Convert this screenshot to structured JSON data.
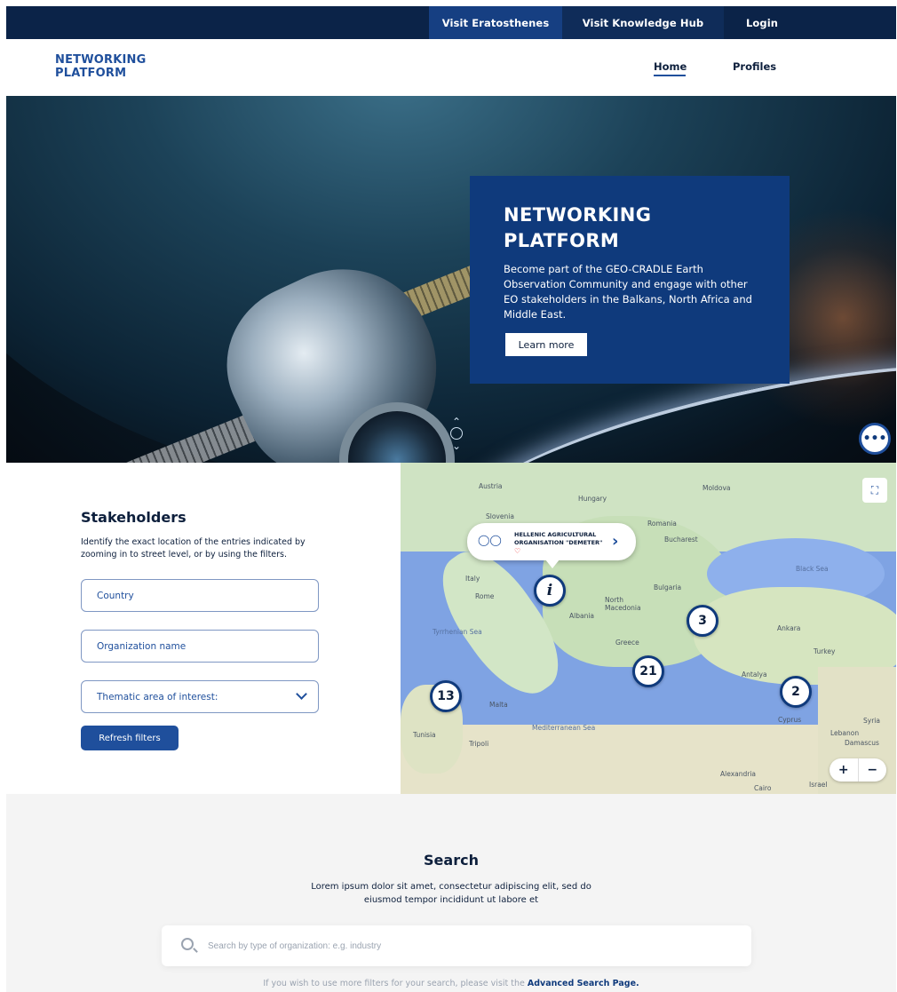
{
  "topbar": {
    "visit_eratosthenes": "Visit Eratosthenes",
    "visit_knowledge_hub": "Visit Knowledge Hub",
    "login": "Login"
  },
  "header": {
    "logo_line1": "NETWORKING",
    "logo_line2": "PLATFORM",
    "nav_home": "Home",
    "nav_profiles": "Profiles"
  },
  "hero": {
    "title_line1": "NETWORKING",
    "title_line2": "PLATFORM",
    "text": "Become part of the GEO-CRADLE Earth Observation Community and engage with other EO stakeholders in the Balkans, North Africa and Middle East.",
    "button": "Learn more",
    "chat_icon": "chat-bubble-icon"
  },
  "stakeholders": {
    "title": "Stakeholders",
    "description": "Identify the exact location of the entries indicated by zooming in to street level, or by using the filters.",
    "country_label": "Country",
    "organization_label": "Organization name",
    "thematic_label": "Thematic area of interest:",
    "refresh_button": "Refresh filters"
  },
  "map": {
    "popup_title": "HELLENIC AGRICULTURAL ORGANISATION \"DEMETER\"",
    "popup_heart": "♡",
    "popup_arrow": "›",
    "marker_info": "i",
    "clusters": [
      "3",
      "21",
      "13",
      "2"
    ],
    "labels": {
      "austria": "Austria",
      "hungary": "Hungary",
      "slovenia": "Slovenia",
      "romania": "Romania",
      "bucharest": "Bucharest",
      "moldova": "Moldova",
      "italy": "Italy",
      "rome": "Rome",
      "bulgaria": "Bulgaria",
      "north_macedonia": "North Macedonia",
      "albania": "Albania",
      "greece": "Greece",
      "turkey": "Turkey",
      "ankara": "Ankara",
      "antalya": "Antalya",
      "cyprus": "Cyprus",
      "syria": "Syria",
      "lebanon": "Lebanon",
      "damascus": "Damascus",
      "israel": "Israel",
      "malta": "Malta",
      "tunisia": "Tunisia",
      "tripoli": "Tripoli",
      "alexandria": "Alexandria",
      "cairo": "Cairo",
      "black_sea": "Black Sea",
      "mediterranean_sea": "Mediterranean Sea",
      "tyrrhenian_sea": "Tyrrhenian Sea"
    },
    "zoom_in": "+",
    "zoom_out": "−",
    "fullscreen_icon": "fullscreen-icon"
  },
  "search": {
    "title": "Search",
    "description": "Lorem ipsum dolor sit amet, consectetur adipiscing elit, sed do eiusmod tempor incididunt ut labore et",
    "placeholder": "Search by type of organization: e.g. industry",
    "footer_text": "If you wish to use more filters for your search, please visit the",
    "footer_link": "Advanced Search Page."
  },
  "colors": {
    "navy": "#0b2348",
    "brand_blue": "#1f4f9c",
    "hero_card": "#0f3a7c"
  }
}
